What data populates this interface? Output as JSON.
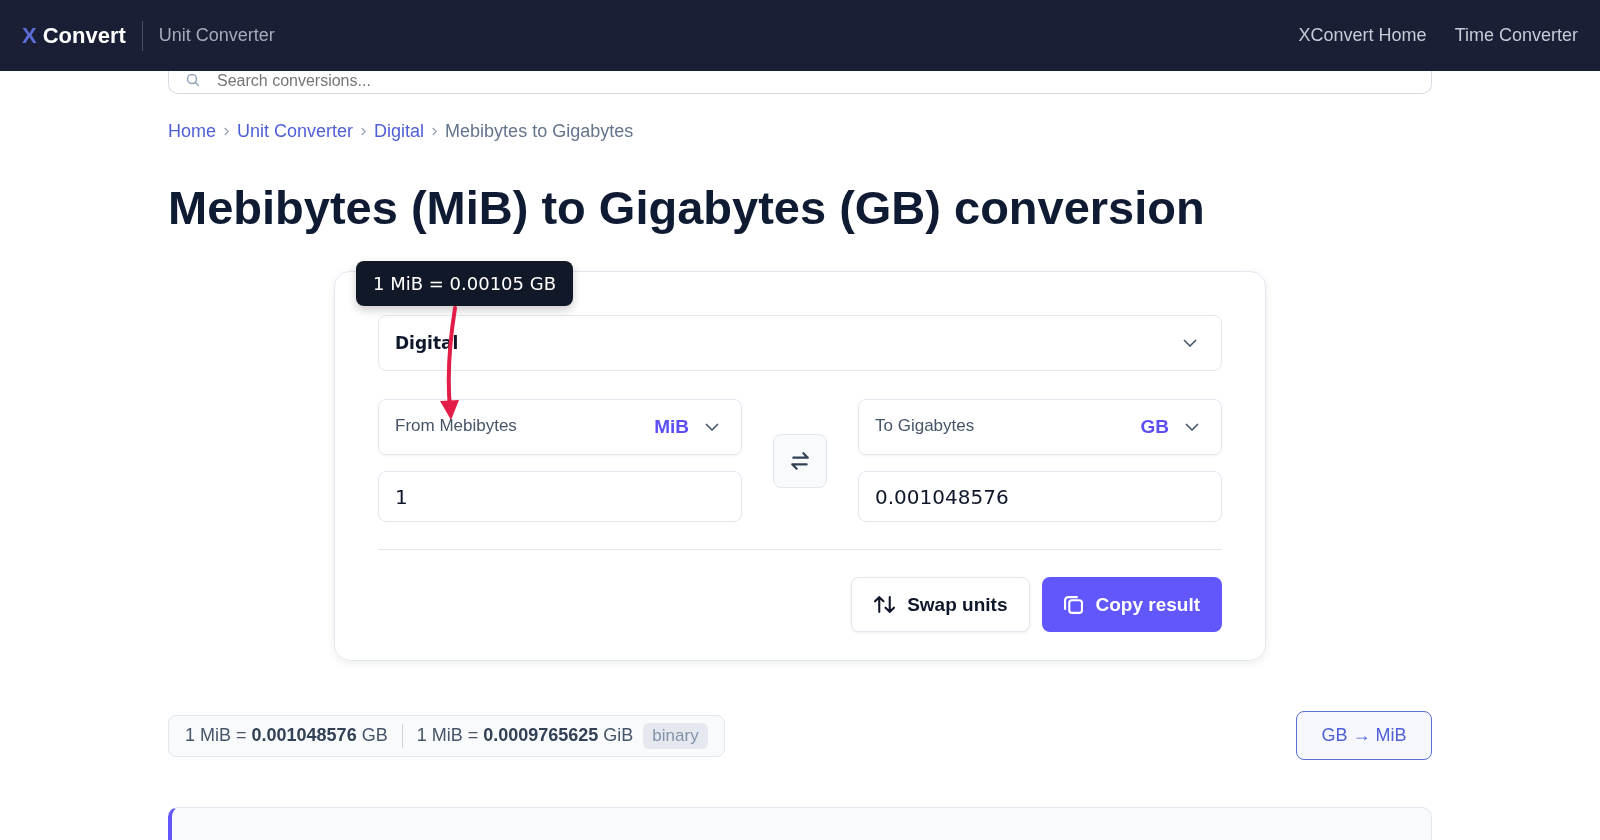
{
  "header": {
    "logo_mark": "X",
    "logo_text": "Convert",
    "section": "Unit Converter",
    "nav": [
      "XConvert Home",
      "Time Converter"
    ]
  },
  "search": {
    "placeholder": "Search conversions..."
  },
  "breadcrumb": [
    {
      "label": "Home",
      "link": true
    },
    {
      "label": "Unit Converter",
      "link": true
    },
    {
      "label": "Digital",
      "link": true
    },
    {
      "label": "Mebibytes to Gigabytes",
      "link": false
    }
  ],
  "title": "Mebibytes (MiB) to Gigabytes (GB) conversion",
  "converter": {
    "tooltip": "1 MiB = 0.00105 GB",
    "category": "Digital",
    "from": {
      "label": "From Mebibytes",
      "unit": "MiB",
      "value": "1"
    },
    "to": {
      "label": "To Gigabytes",
      "unit": "GB",
      "value": "0.001048576"
    },
    "buttons": [
      {
        "kind": "secondary",
        "label": "Swap units"
      },
      {
        "kind": "primary",
        "label": "Copy result"
      }
    ]
  },
  "facts": [
    {
      "text": "1 MiB = **0.001048576** GB"
    },
    {
      "text": "1 MiB = **0.0009765625** GiB",
      "tag": "binary"
    }
  ],
  "reverse_link": "GB → MiB"
}
